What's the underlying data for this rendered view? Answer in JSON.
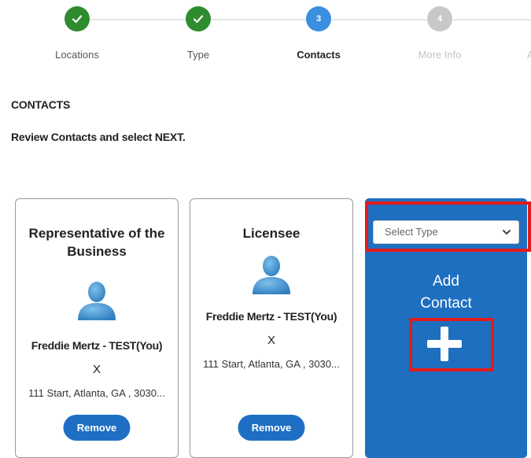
{
  "stepper": {
    "steps": [
      {
        "label": "Locations",
        "state": "done",
        "number": ""
      },
      {
        "label": "Type",
        "state": "done",
        "number": ""
      },
      {
        "label": "Contacts",
        "state": "active",
        "number": "3"
      },
      {
        "label": "More Info",
        "state": "todo",
        "number": "4"
      }
    ],
    "partial_label": "A"
  },
  "section": {
    "title": "CONTACTS",
    "instructions": "Review Contacts and select NEXT."
  },
  "cards": [
    {
      "role": "Representative of the Business",
      "name": "Freddie Mertz - TEST(You)",
      "x": "X",
      "address": "111 Start, Atlanta, GA , 3030...",
      "remove_label": "Remove"
    },
    {
      "role": "Licensee",
      "name": "Freddie Mertz - TEST(You)",
      "x": "X",
      "address": "111 Start, Atlanta, GA , 3030...",
      "remove_label": "Remove"
    }
  ],
  "add_contact": {
    "select_placeholder": "Select Type",
    "label_line1": "Add",
    "label_line2": "Contact",
    "icon": "plus-icon"
  },
  "colors": {
    "done": "#2e8b2e",
    "active": "#3b8fe0",
    "todo": "#c8c8c8",
    "accent_blue": "#1f6fc0",
    "button_blue": "#1e6fc4",
    "highlight_red": "#e31b1b"
  }
}
